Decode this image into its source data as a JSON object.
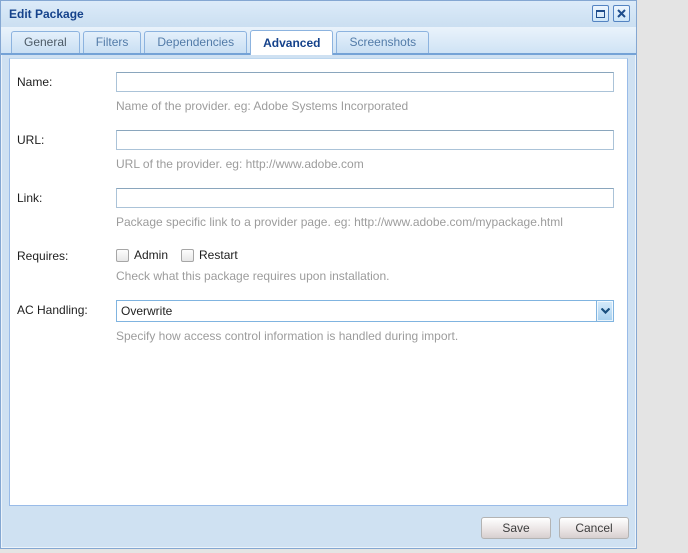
{
  "window": {
    "title": "Edit Package",
    "controls": {
      "restore_icon": "restore-icon",
      "close_icon": "close-icon"
    }
  },
  "tabs": [
    {
      "label": "General",
      "active": false
    },
    {
      "label": "Filters",
      "active": false
    },
    {
      "label": "Dependencies",
      "active": false
    },
    {
      "label": "Advanced",
      "active": true
    },
    {
      "label": "Screenshots",
      "active": false
    }
  ],
  "form": {
    "rows": [
      {
        "type": "text",
        "label": "Name:",
        "value": "",
        "help": "Name of the provider. eg: Adobe Systems Incorporated"
      },
      {
        "type": "text",
        "label": "URL:",
        "value": "",
        "help": "URL of the provider. eg: http://www.adobe.com"
      },
      {
        "type": "text",
        "label": "Link:",
        "value": "",
        "help": "Package specific link to a provider page. eg: http://www.adobe.com/mypackage.html"
      },
      {
        "type": "checkbox-group",
        "label": "Requires:",
        "options": [
          {
            "label": "Admin",
            "checked": false
          },
          {
            "label": "Restart",
            "checked": false
          }
        ],
        "help": "Check what this package requires upon installation."
      },
      {
        "type": "combo",
        "label": "AC Handling:",
        "value": "Overwrite",
        "help": "Specify how access control information is handled during import."
      }
    ]
  },
  "footer": {
    "buttons": [
      {
        "label": "Save"
      },
      {
        "label": "Cancel"
      }
    ]
  },
  "colors": {
    "title_text": "#15428b",
    "frame": "#cfe1f2",
    "frame_border": "#84a7d2",
    "tab_active_text": "#15428b",
    "tab_inactive_text": "#527ba8",
    "help_text": "#9c9c9c",
    "input_border": "#abc3d8",
    "combo_border": "#80b4e0",
    "page_background": "#e4e4e4"
  }
}
